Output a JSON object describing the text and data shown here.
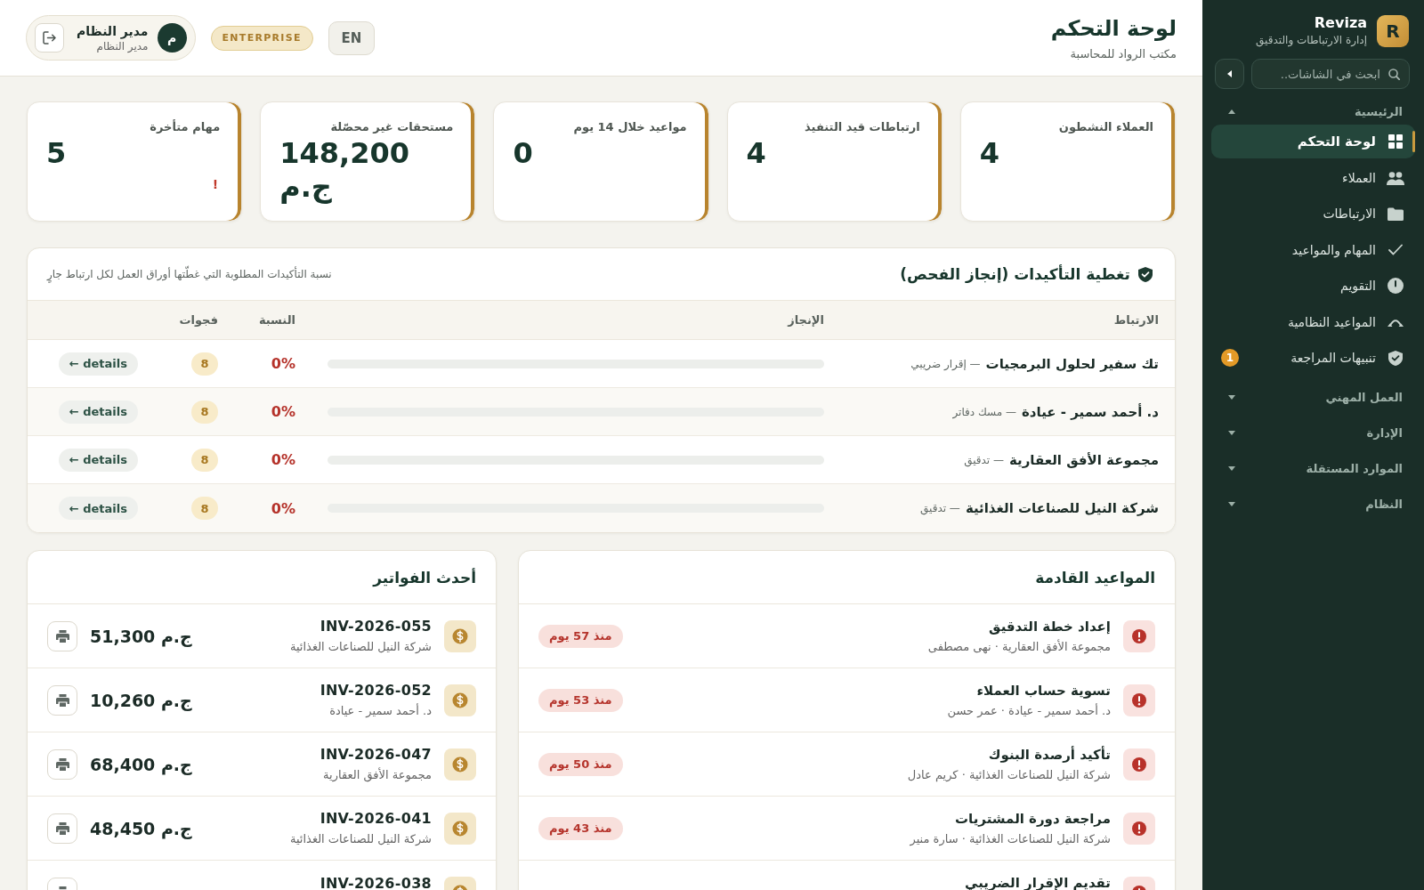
{
  "sidebar": {
    "brand": {
      "logo": "R",
      "name": "Reviza",
      "tagline": "إدارة الارتباطات والتدقيق"
    },
    "search": {
      "placeholder": "ابحث في الشاشات.."
    },
    "sections": [
      {
        "label": "الرئيسية",
        "expanded": true,
        "items": [
          {
            "label": "لوحة التحكم",
            "selected": true
          },
          {
            "label": "العملاء",
            "selected": false
          },
          {
            "label": "الارتباطات",
            "selected": false
          },
          {
            "label": "المهام والمواعيد",
            "selected": false
          },
          {
            "label": "التقويم",
            "selected": false
          },
          {
            "label": "المواعيد النظامية",
            "selected": false
          },
          {
            "label": "تنبيهات المراجعة",
            "selected": false,
            "badge": "1"
          }
        ]
      },
      {
        "label": "العمل المهني",
        "expanded": false
      },
      {
        "label": "الإدارة",
        "expanded": false
      },
      {
        "label": "الموارد المستقلة",
        "expanded": false
      },
      {
        "label": "النظام",
        "expanded": false
      }
    ]
  },
  "header": {
    "title": "لوحة التحكم",
    "subtitle": "مكتب الرواد للمحاسبة",
    "language": "EN",
    "plan": "ENTERPRISE",
    "user": {
      "initial": "م",
      "name": "مدير النظام",
      "role": "مدير النظام"
    }
  },
  "kpis": [
    {
      "label": "العملاء النشطون",
      "value": "4"
    },
    {
      "label": "ارتباطات قيد التنفيذ",
      "value": "4"
    },
    {
      "label": "مواعيد خلال 14 يوم",
      "value": "0"
    },
    {
      "label": "مستحقات غير محصّلة",
      "value": "148,200 ج.م"
    },
    {
      "label": "مهام متأخرة",
      "value": "5",
      "alert": "!"
    }
  ],
  "coverage": {
    "title": "تغطية التأكيدات (إنجاز الفحص)",
    "description": "نسبة التأكيدات المطلوبة التي غطّتها أوراق العمل لكل ارتباط جارٍ",
    "columns": [
      "الارتباط",
      "الإنجاز",
      "النسبة",
      "فجوات"
    ],
    "rows": [
      {
        "engagement": "تك سفير لحلول البرمجيات",
        "type": "— إقرار ضريبي",
        "level": 0,
        "percent": "0%",
        "gaps": "8",
        "action": "← details"
      },
      {
        "engagement": "د. أحمد سمير - عيادة",
        "type": "— مسك دفاتر",
        "level": 0,
        "percent": "0%",
        "gaps": "8",
        "action": "← details"
      },
      {
        "engagement": "مجموعة الأفق العقارية",
        "type": "— تدقيق",
        "level": 0,
        "percent": "0%",
        "gaps": "8",
        "action": "← details"
      },
      {
        "engagement": "شركة النيل للصناعات الغذائية",
        "type": "— تدقيق",
        "level": 0,
        "percent": "0%",
        "gaps": "8",
        "action": "← details"
      }
    ]
  },
  "upcoming": {
    "title": "المواعيد القادمة",
    "items": [
      {
        "title": "إعداد خطة التدقيق",
        "meta": "مجموعة الأفق العقارية · نهى مصطفى",
        "badge": "منذ 57 يوم"
      },
      {
        "title": "تسوية حساب العملاء",
        "meta": "د. أحمد سمير - عيادة · عمر حسن",
        "badge": "منذ 53 يوم"
      },
      {
        "title": "تأكيد أرصدة البنوك",
        "meta": "شركة النيل للصناعات الغذائية · كريم عادل",
        "badge": "منذ 50 يوم"
      },
      {
        "title": "مراجعة دورة المشتريات",
        "meta": "شركة النيل للصناعات الغذائية · سارة منير",
        "badge": "منذ 43 يوم"
      },
      {
        "title": "تقديم الإقرار الضريبي"
      }
    ]
  },
  "invoices": {
    "title": "أحدث الفواتير",
    "items": [
      {
        "number": "INV-2026-055",
        "client": "شركة النيل للصناعات الغذائية",
        "amount": "51,300 ج.م"
      },
      {
        "number": "INV-2026-052",
        "client": "د. أحمد سمير - عيادة",
        "amount": "10,260 ج.م"
      },
      {
        "number": "INV-2026-047",
        "client": "مجموعة الأفق العقارية",
        "amount": "68,400 ج.م"
      },
      {
        "number": "INV-2026-041",
        "client": "شركة النيل للصناعات الغذائية",
        "amount": "48,450 ج.م"
      },
      {
        "number": "INV-2026-038"
      }
    ]
  }
}
